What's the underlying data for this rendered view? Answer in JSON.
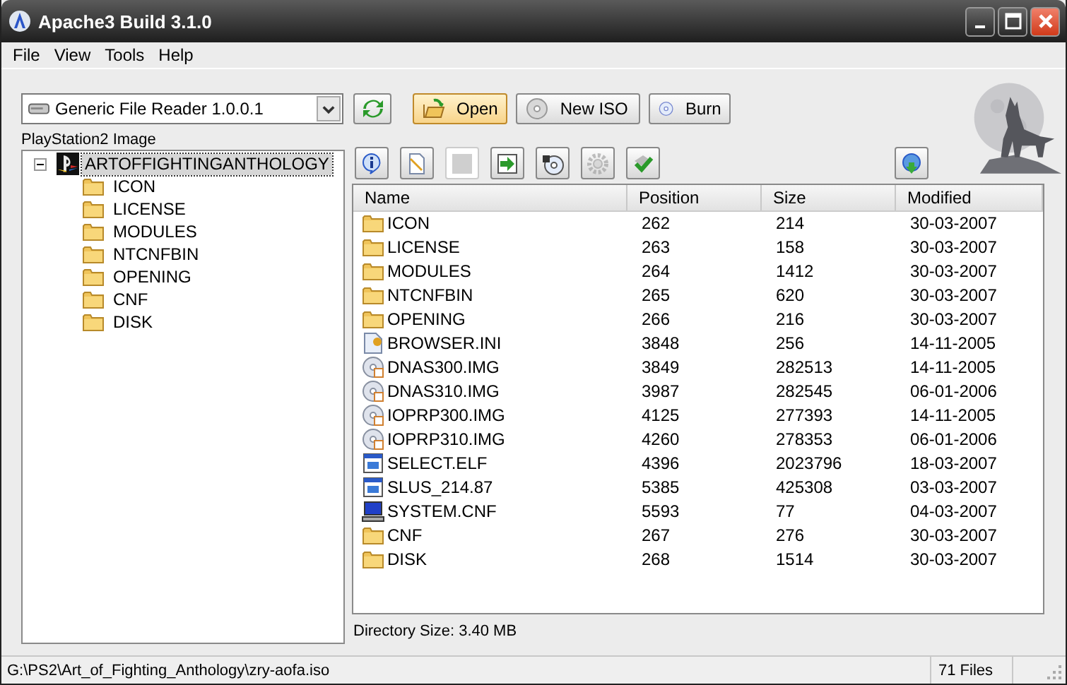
{
  "window": {
    "title": "Apache3 Build 3.1.0"
  },
  "menu": [
    "File",
    "View",
    "Tools",
    "Help"
  ],
  "reader": {
    "value": "Generic File Reader 1.0.0.1"
  },
  "buttons": [
    {
      "kind": "refresh"
    },
    {
      "kind": "open",
      "label": "Open",
      "selected": true
    },
    {
      "kind": "newiso",
      "label": "New ISO",
      "selected": false
    },
    {
      "kind": "burn",
      "label": "Burn",
      "selected": false
    }
  ],
  "tree_label": "PlayStation2 Image",
  "tree": {
    "label": "ARTOFFIGHTINGANTHOLOGY",
    "expanded": true,
    "selected": true,
    "children": [
      {
        "label": "ICON"
      },
      {
        "label": "LICENSE"
      },
      {
        "label": "MODULES"
      },
      {
        "label": "NTCNFBIN"
      },
      {
        "label": "OPENING"
      },
      {
        "label": "CNF"
      },
      {
        "label": "DISK"
      }
    ]
  },
  "tools": [
    {
      "kind": "info"
    },
    {
      "kind": "edit"
    },
    {
      "kind": "stop",
      "disabled": true
    },
    {
      "kind": "import"
    },
    {
      "kind": "disc"
    },
    {
      "kind": "settings",
      "disabled": true
    },
    {
      "kind": "check"
    },
    {
      "kind": "update"
    }
  ],
  "table": {
    "columns": [
      "Name",
      "Position",
      "Size",
      "Modified"
    ],
    "rows": [
      {
        "kind": "folder",
        "cells": [
          "ICON",
          "262",
          "214",
          "30-03-2007"
        ]
      },
      {
        "kind": "folder",
        "cells": [
          "LICENSE",
          "263",
          "158",
          "30-03-2007"
        ]
      },
      {
        "kind": "folder",
        "cells": [
          "MODULES",
          "264",
          "1412",
          "30-03-2007"
        ]
      },
      {
        "kind": "folder",
        "cells": [
          "NTCNFBIN",
          "265",
          "620",
          "30-03-2007"
        ]
      },
      {
        "kind": "folder",
        "cells": [
          "OPENING",
          "266",
          "216",
          "30-03-2007"
        ]
      },
      {
        "kind": "config",
        "cells": [
          "BROWSER.INI",
          "3848",
          "256",
          "14-11-2005"
        ]
      },
      {
        "kind": "disc",
        "cells": [
          "DNAS300.IMG",
          "3849",
          "282513",
          "14-11-2005"
        ]
      },
      {
        "kind": "disc",
        "cells": [
          "DNAS310.IMG",
          "3987",
          "282545",
          "06-01-2006"
        ]
      },
      {
        "kind": "disc",
        "cells": [
          "IOPRP300.IMG",
          "4125",
          "277393",
          "14-11-2005"
        ]
      },
      {
        "kind": "disc",
        "cells": [
          "IOPRP310.IMG",
          "4260",
          "278353",
          "06-01-2006"
        ]
      },
      {
        "kind": "program",
        "cells": [
          "SELECT.ELF",
          "4396",
          "2023796",
          "18-03-2007"
        ]
      },
      {
        "kind": "program",
        "cells": [
          "SLUS_214.87",
          "5385",
          "425308",
          "03-03-2007"
        ]
      },
      {
        "kind": "system",
        "cells": [
          "SYSTEM.CNF",
          "5593",
          "77",
          "04-03-2007"
        ]
      },
      {
        "kind": "folder",
        "cells": [
          "CNF",
          "267",
          "276",
          "30-03-2007"
        ]
      },
      {
        "kind": "folder",
        "cells": [
          "DISK",
          "268",
          "1514",
          "30-03-2007"
        ]
      }
    ]
  },
  "directory_size": "Directory Size: 3.40 MB",
  "status_bar": {
    "path": "G:\\PS2\\Art_of_Fighting_Anthology\\zry-aofa.iso",
    "count": "71 Files"
  }
}
